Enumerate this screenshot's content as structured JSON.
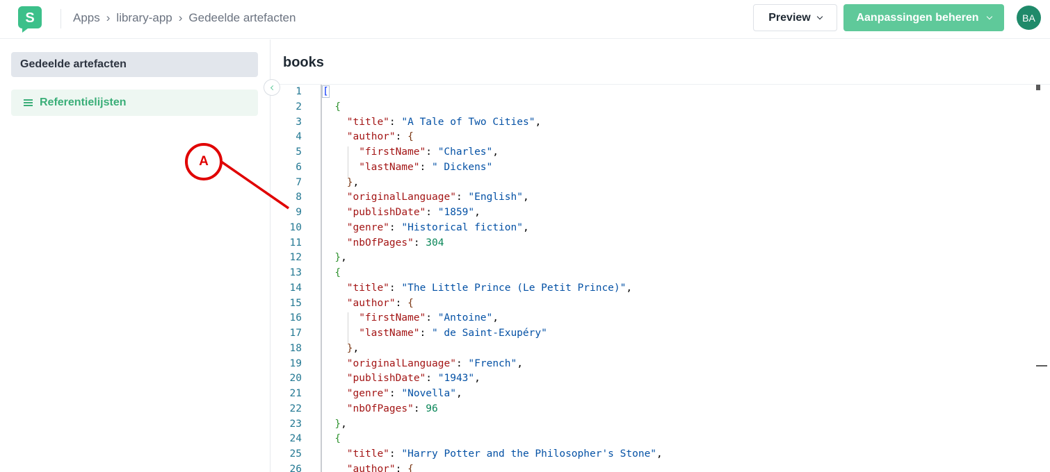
{
  "header": {
    "breadcrumb": [
      "Apps",
      "library-app",
      "Gedeelde artefacten"
    ],
    "preview_label": "Preview",
    "manage_label": "Aanpassingen beheren",
    "avatar_initials": "BA",
    "accent_color": "#5fc99a"
  },
  "sidebar": {
    "heading": "Gedeelde artefacten",
    "items": [
      {
        "label": "Referentielijsten",
        "icon": "list-icon"
      }
    ]
  },
  "main": {
    "title": "books"
  },
  "annotation": {
    "label": "A"
  },
  "editor": {
    "lines": [
      {
        "n": "1",
        "indent": 0,
        "tokens": [
          [
            "b1",
            "["
          ]
        ]
      },
      {
        "n": "2",
        "indent": 1,
        "tokens": [
          [
            "b2",
            "{"
          ]
        ]
      },
      {
        "n": "3",
        "indent": 2,
        "tokens": [
          [
            "k",
            "\"title\""
          ],
          [
            "p",
            ": "
          ],
          [
            "s",
            "\"A Tale of Two Cities\""
          ],
          [
            "p",
            ","
          ]
        ]
      },
      {
        "n": "4",
        "indent": 2,
        "tokens": [
          [
            "k",
            "\"author\""
          ],
          [
            "p",
            ": "
          ],
          [
            "b3",
            "{"
          ]
        ]
      },
      {
        "n": "5",
        "indent": 3,
        "tokens": [
          [
            "k",
            "\"firstName\""
          ],
          [
            "p",
            ": "
          ],
          [
            "s",
            "\"Charles\""
          ],
          [
            "p",
            ","
          ]
        ]
      },
      {
        "n": "6",
        "indent": 3,
        "tokens": [
          [
            "k",
            "\"lastName\""
          ],
          [
            "p",
            ": "
          ],
          [
            "s",
            "\" Dickens\""
          ]
        ]
      },
      {
        "n": "7",
        "indent": 2,
        "tokens": [
          [
            "b3",
            "}"
          ],
          [
            "p",
            ","
          ]
        ]
      },
      {
        "n": "8",
        "indent": 2,
        "tokens": [
          [
            "k",
            "\"originalLanguage\""
          ],
          [
            "p",
            ": "
          ],
          [
            "s",
            "\"English\""
          ],
          [
            "p",
            ","
          ]
        ]
      },
      {
        "n": "9",
        "indent": 2,
        "tokens": [
          [
            "k",
            "\"publishDate\""
          ],
          [
            "p",
            ": "
          ],
          [
            "s",
            "\"1859\""
          ],
          [
            "p",
            ","
          ]
        ]
      },
      {
        "n": "10",
        "indent": 2,
        "tokens": [
          [
            "k",
            "\"genre\""
          ],
          [
            "p",
            ": "
          ],
          [
            "s",
            "\"Historical fiction\""
          ],
          [
            "p",
            ","
          ]
        ]
      },
      {
        "n": "11",
        "indent": 2,
        "tokens": [
          [
            "k",
            "\"nbOfPages\""
          ],
          [
            "p",
            ": "
          ],
          [
            "n",
            "304"
          ]
        ]
      },
      {
        "n": "12",
        "indent": 1,
        "tokens": [
          [
            "b2",
            "}"
          ],
          [
            "p",
            ","
          ]
        ]
      },
      {
        "n": "13",
        "indent": 1,
        "tokens": [
          [
            "b2",
            "{"
          ]
        ]
      },
      {
        "n": "14",
        "indent": 2,
        "tokens": [
          [
            "k",
            "\"title\""
          ],
          [
            "p",
            ": "
          ],
          [
            "s",
            "\"The Little Prince (Le Petit Prince)\""
          ],
          [
            "p",
            ","
          ]
        ]
      },
      {
        "n": "15",
        "indent": 2,
        "tokens": [
          [
            "k",
            "\"author\""
          ],
          [
            "p",
            ": "
          ],
          [
            "b3",
            "{"
          ]
        ]
      },
      {
        "n": "16",
        "indent": 3,
        "tokens": [
          [
            "k",
            "\"firstName\""
          ],
          [
            "p",
            ": "
          ],
          [
            "s",
            "\"Antoine\""
          ],
          [
            "p",
            ","
          ]
        ]
      },
      {
        "n": "17",
        "indent": 3,
        "tokens": [
          [
            "k",
            "\"lastName\""
          ],
          [
            "p",
            ": "
          ],
          [
            "s",
            "\" de Saint-Exupéry\""
          ]
        ]
      },
      {
        "n": "18",
        "indent": 2,
        "tokens": [
          [
            "b3",
            "}"
          ],
          [
            "p",
            ","
          ]
        ]
      },
      {
        "n": "19",
        "indent": 2,
        "tokens": [
          [
            "k",
            "\"originalLanguage\""
          ],
          [
            "p",
            ": "
          ],
          [
            "s",
            "\"French\""
          ],
          [
            "p",
            ","
          ]
        ]
      },
      {
        "n": "20",
        "indent": 2,
        "tokens": [
          [
            "k",
            "\"publishDate\""
          ],
          [
            "p",
            ": "
          ],
          [
            "s",
            "\"1943\""
          ],
          [
            "p",
            ","
          ]
        ]
      },
      {
        "n": "21",
        "indent": 2,
        "tokens": [
          [
            "k",
            "\"genre\""
          ],
          [
            "p",
            ": "
          ],
          [
            "s",
            "\"Novella\""
          ],
          [
            "p",
            ","
          ]
        ]
      },
      {
        "n": "22",
        "indent": 2,
        "tokens": [
          [
            "k",
            "\"nbOfPages\""
          ],
          [
            "p",
            ": "
          ],
          [
            "n",
            "96"
          ]
        ]
      },
      {
        "n": "23",
        "indent": 1,
        "tokens": [
          [
            "b2",
            "}"
          ],
          [
            "p",
            ","
          ]
        ]
      },
      {
        "n": "24",
        "indent": 1,
        "tokens": [
          [
            "b2",
            "{"
          ]
        ]
      },
      {
        "n": "25",
        "indent": 2,
        "tokens": [
          [
            "k",
            "\"title\""
          ],
          [
            "p",
            ": "
          ],
          [
            "s",
            "\"Harry Potter and the Philosopher's Stone\""
          ],
          [
            "p",
            ","
          ]
        ]
      },
      {
        "n": "26",
        "indent": 2,
        "tokens": [
          [
            "k",
            "\"author\""
          ],
          [
            "p",
            ": "
          ],
          [
            "b3",
            "{"
          ]
        ]
      }
    ]
  }
}
